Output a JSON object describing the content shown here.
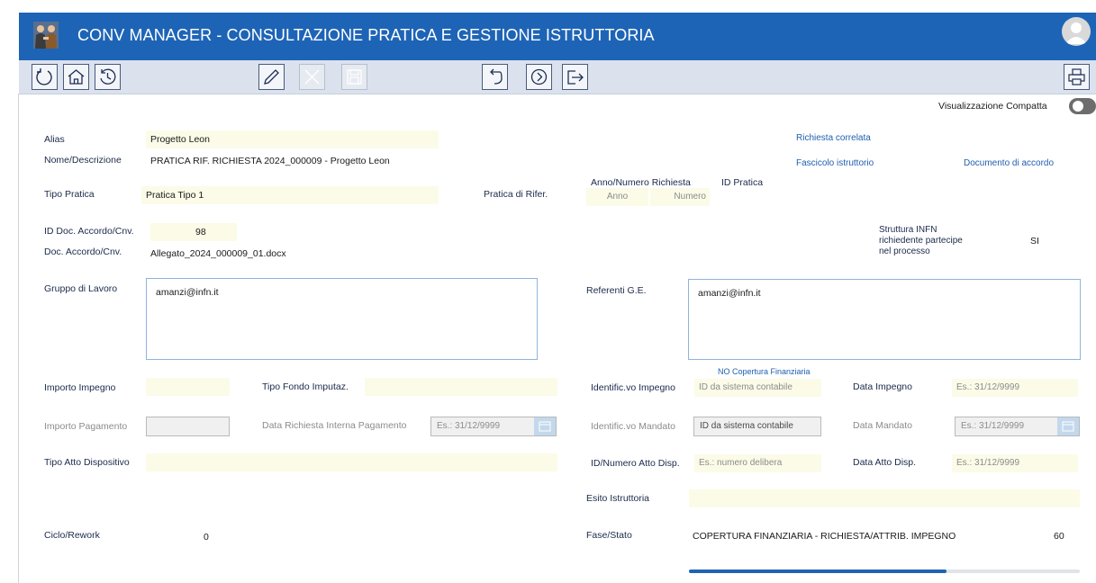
{
  "app": {
    "title": "CONV MANAGER - CONSULTAZIONE PRATICA E GESTIONE ISTRUTTORIA"
  },
  "toolbar": {
    "buttons": [
      "refresh-icon",
      "home-icon",
      "history-icon",
      "edit-icon",
      "cancel-icon",
      "save-icon",
      "undo-icon",
      "next-icon",
      "exit-icon",
      "print-icon"
    ]
  },
  "compact_view": {
    "label": "Visualizzazione Compatta",
    "enabled": false
  },
  "links": {
    "richiesta_correlata": "Richiesta correlata",
    "fascicolo": "Fascicolo istruttorio",
    "documento": "Documento di accordo"
  },
  "fields": {
    "alias": {
      "label": "Alias",
      "value": "Progetto Leon"
    },
    "nome": {
      "label": "Nome/Descrizione",
      "value": "PRATICA RIF. RICHIESTA 2024_000009 - Progetto Leon"
    },
    "tipo_pratica": {
      "label": "Tipo Pratica",
      "value": "Pratica Tipo 1"
    },
    "pratica_rif": {
      "label": "Pratica di Rifer."
    },
    "anno_numero": {
      "label": "Anno/Numero Richiesta",
      "anno_placeholder": "Anno",
      "numero_placeholder": "Numero"
    },
    "id_pratica": {
      "label": "ID Pratica"
    },
    "id_doc": {
      "label": "ID Doc. Accordo/Cnv.",
      "value": "98"
    },
    "doc_accordo": {
      "label": "Doc. Accordo/Cnv.",
      "value": "Allegato_2024_000009_01.docx"
    },
    "struttura": {
      "label_1": "Struttura INFN",
      "label_2": "richiedente partecipe",
      "label_3": "nel processo",
      "value": "SI"
    },
    "gruppo_lavoro": {
      "label": "Gruppo di Lavoro",
      "value": "amanzi@infn.it"
    },
    "referenti": {
      "label": "Referenti G.E.",
      "value": "amanzi@infn.it"
    },
    "copertura_note": "NO Copertura Finanziaria",
    "importo_impegno": {
      "label": "Importo Impegno",
      "value": ""
    },
    "tipo_fondo": {
      "label": "Tipo Fondo Imputaz.",
      "value": ""
    },
    "identificativo_impegno": {
      "label": "Identific.vo Impegno",
      "placeholder": "ID da sistema contabile"
    },
    "data_impegno": {
      "label": "Data Impegno",
      "placeholder": "Es.: 31/12/9999"
    },
    "importo_pagamento": {
      "label": "Importo Pagamento"
    },
    "data_richiesta_pagamento": {
      "label": "Data Richiesta Interna Pagamento",
      "placeholder": "Es.: 31/12/9999"
    },
    "identificativo_mandato": {
      "label": "Identific.vo Mandato",
      "placeholder": "ID da sistema contabile"
    },
    "data_mandato": {
      "label": "Data Mandato",
      "placeholder": "Es.: 31/12/9999"
    },
    "tipo_atto": {
      "label": "Tipo Atto Dispositivo",
      "value": ""
    },
    "id_atto": {
      "label": "ID/Numero Atto Disp.",
      "placeholder": "Es.: numero delibera"
    },
    "data_atto": {
      "label": "Data Atto Disp.",
      "placeholder": "Es.: 31/12/9999"
    },
    "esito": {
      "label": "Esito Istruttoria",
      "value": ""
    },
    "ciclo": {
      "label": "Ciclo/Rework",
      "value": "0"
    },
    "fase": {
      "label": "Fase/Stato",
      "value": "COPERTURA FINANZIARIA - RICHIESTA/ATTRIB. IMPEGNO",
      "number": "60"
    }
  },
  "progress": {
    "fraction": 0.66
  },
  "colors": {
    "header": "#1e64b6",
    "toolbar": "#dbe2ee",
    "field_yellow": "#fbfbe8",
    "link": "#1f5fae"
  }
}
